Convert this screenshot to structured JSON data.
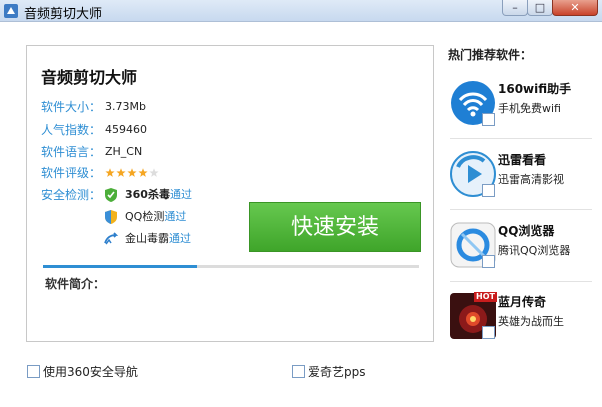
{
  "window": {
    "title": "音频剪切大师",
    "min_glyph": "–",
    "max_glyph": "□",
    "close_glyph": "✕"
  },
  "app": {
    "name": "音频剪切大师",
    "info": [
      {
        "label": "软件大小：",
        "value": "3.73Mb"
      },
      {
        "label": "人气指数：",
        "value": "459460"
      },
      {
        "label": "软件语言：",
        "value": "ZH_CN"
      },
      {
        "label": "软件评级：",
        "rating": 4,
        "max_rating": 5
      }
    ],
    "security_label": "安全检测：",
    "security": [
      {
        "name": "360杀毒",
        "status": "通过",
        "icon": "360-shield-icon"
      },
      {
        "name": "QQ检测",
        "status": "通过",
        "icon": "qq-shield-icon"
      },
      {
        "name": "金山毒霸",
        "status": "通过",
        "icon": "kingsoft-icon"
      }
    ],
    "install_label": "快速安装",
    "progress": 0.41,
    "intro_label": "软件简介："
  },
  "recommend": {
    "title": "热门推荐软件：",
    "items": [
      {
        "name": "160wifi助手",
        "desc": "手机免费wifi",
        "icon": "wifi-icon"
      },
      {
        "name": "迅雷看看",
        "desc": "迅雷高清影视",
        "icon": "xunlei-play-icon"
      },
      {
        "name": "QQ浏览器",
        "desc": "腾讯QQ浏览器",
        "icon": "qq-browser-icon"
      },
      {
        "name": "蓝月传奇",
        "desc": "英雄为战而生",
        "icon": "game-icon",
        "badge": "HOT"
      }
    ]
  },
  "options": [
    {
      "label": "使用360安全导航"
    },
    {
      "label": "爱奇艺pps"
    }
  ],
  "colors": {
    "accent": "#2e8ed3",
    "install_green": "#4cb533",
    "star": "#f5a623"
  }
}
